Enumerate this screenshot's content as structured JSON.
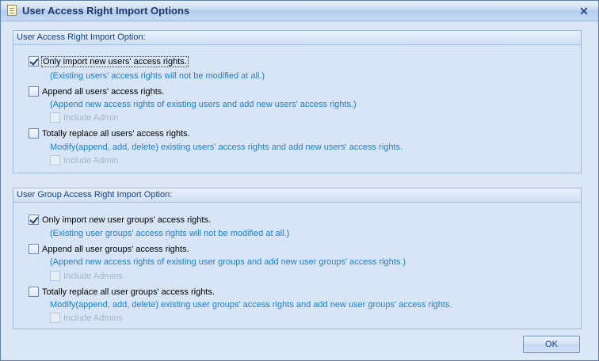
{
  "window": {
    "title": "User Access Right Import Options",
    "close_glyph": "✕"
  },
  "users_group": {
    "header": "User Access Right Import Option:",
    "options": [
      {
        "label": "Only import new users' access rights.",
        "checked": true,
        "description": "(Existing users' access rights will not be modified at all.)"
      },
      {
        "label": "Append all users' access rights.",
        "checked": false,
        "description": "(Append new access rights of existing users and add new users' access rights.)",
        "sub_option": "Include Admin"
      },
      {
        "label": "Totally replace all users' access rights.",
        "checked": false,
        "description": "Modify(append, add, delete) existing users' access rights and add new users' access rights.",
        "sub_option": "Include Admin"
      }
    ]
  },
  "groups_group": {
    "header": "User Group Access Right Import Option:",
    "options": [
      {
        "label": "Only import new user groups' access rights.",
        "checked": true,
        "description": "(Existing user groups' access rights will not be modified at all.)"
      },
      {
        "label": "Append all user groups' access rights.",
        "checked": false,
        "description": "(Append new access rights of existing user groups and add new user groups' access rights.)",
        "sub_option": "Include Admins"
      },
      {
        "label": "Totally replace all user groups' access rights.",
        "checked": false,
        "description": "Modify(append, add, delete) existing user groups' access rights and add new user groups' access rights.",
        "sub_option": "Include Admins"
      }
    ]
  },
  "footer": {
    "ok_label": "OK"
  },
  "colors": {
    "window_bg": "#dbe7f7",
    "title_text": "#1e3a6e",
    "group_header_text": "#15428b",
    "description_text": "#1a7fd4",
    "disabled_text": "#a7b5c7"
  },
  "icons": {
    "title_icon": "document-icon",
    "close": "close-icon"
  }
}
